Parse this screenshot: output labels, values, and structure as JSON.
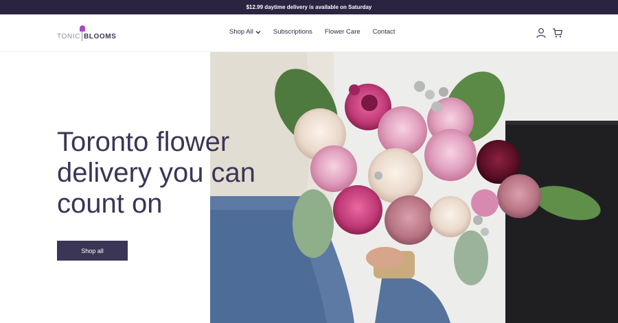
{
  "announcement": "$12.99 daytime delivery is available on Saturday",
  "logo": {
    "word1": "TONIC",
    "word2": "BLOOMS"
  },
  "nav": {
    "items": [
      {
        "label": "Shop All",
        "has_dropdown": true
      },
      {
        "label": "Subscriptions"
      },
      {
        "label": "Flower Care"
      },
      {
        "label": "Contact"
      }
    ]
  },
  "header_icons": [
    "user-icon",
    "cart-icon"
  ],
  "hero": {
    "headline": "Toronto flower delivery you can count on",
    "cta_label": "Shop all"
  },
  "colors": {
    "brand": "#3b3556",
    "announcement_bg": "#2a2440",
    "logo_accent": "#a948c9"
  }
}
